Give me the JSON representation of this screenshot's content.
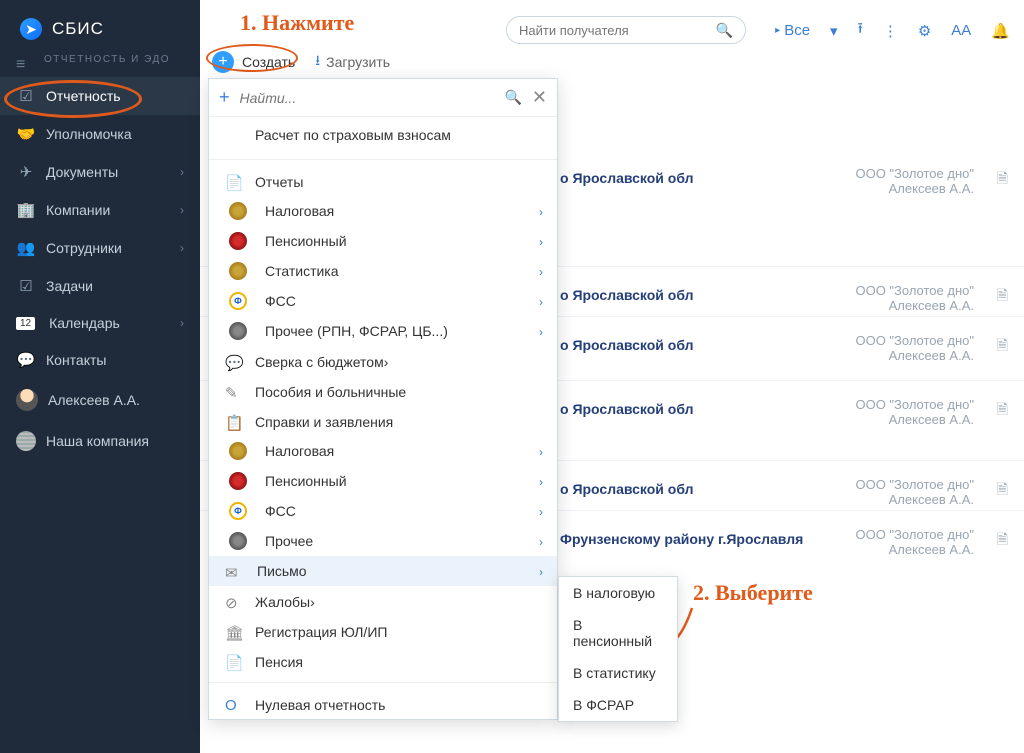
{
  "app": {
    "name": "СБИС",
    "section": "ОТЧЕТНОСТЬ И ЭДО"
  },
  "sidebar": [
    {
      "label": "Отчетность",
      "icon": "☑",
      "hasChev": false,
      "active": true
    },
    {
      "label": "Уполномочка",
      "icon": "🤝",
      "hasChev": false
    },
    {
      "label": "Документы",
      "icon": "✈",
      "hasChev": true
    },
    {
      "label": "Компании",
      "icon": "🏢",
      "hasChev": true
    },
    {
      "label": "Сотрудники",
      "icon": "👥",
      "hasChev": true
    },
    {
      "label": "Задачи",
      "icon": "☑",
      "hasChev": false
    },
    {
      "label": "Календарь",
      "icon": "",
      "badge": "12",
      "hasChev": true
    },
    {
      "label": "Контакты",
      "icon": "💬",
      "hasChev": false
    },
    {
      "label": "Алексеев А.А.",
      "avatar": true
    },
    {
      "label": "Наша компания",
      "circ": true
    }
  ],
  "search": {
    "placeholder": "Найти получателя"
  },
  "filter": {
    "label": "Все"
  },
  "toolbar": {
    "create": "Создать",
    "upload": "Загрузить"
  },
  "annotations": {
    "a1": "1. Нажмите",
    "a2": "2. Выберите"
  },
  "rows": [
    {
      "title": "о Ярославской обл",
      "org": "ООО \"Золотое дно\"",
      "person": "Алексеев А.А."
    },
    {
      "title": "о Ярославской обл",
      "org": "ООО \"Золотое дно\"",
      "person": "Алексеев А.А."
    },
    {
      "title": "о Ярославской обл",
      "org": "ООО \"Золотое дно\"",
      "person": "Алексеев А.А."
    },
    {
      "title": "о Ярославской обл",
      "org": "ООО \"Золотое дно\"",
      "person": "Алексеев А.А."
    },
    {
      "title": "о Ярославской обл",
      "org": "ООО \"Золотое дно\"",
      "person": "Алексеев А.А."
    },
    {
      "title": "Фрунзенскому району г.Ярославля",
      "org": "ООО \"Золотое дно\"",
      "person": "Алексеев А.А."
    }
  ],
  "row_offsets": [
    60,
    176,
    226,
    290,
    370,
    420
  ],
  "panel": {
    "search_placeholder": "Найти...",
    "recent": "Расчет по страховым взносам",
    "groups": [
      {
        "title": "Отчеты",
        "icon": "📄",
        "items": [
          {
            "label": "Налоговая",
            "iic": "eagle-g",
            "chev": true
          },
          {
            "label": "Пенсионный",
            "iic": "eagle-r",
            "chev": true
          },
          {
            "label": "Статистика",
            "iic": "eagle-g",
            "chev": true
          },
          {
            "label": "ФСС",
            "iic": "fss",
            "chev": true
          },
          {
            "label": "Прочее (РПН, ФСРАР, ЦБ...)",
            "iic": "eagle-k",
            "chev": true
          }
        ]
      },
      {
        "title": "Сверка с бюджетом",
        "icon": "💬",
        "chev": true
      },
      {
        "title": "Пособия и больничные",
        "icon": "✎"
      },
      {
        "title": "Справки и заявления",
        "icon": "📋",
        "items": [
          {
            "label": "Налоговая",
            "iic": "eagle-g",
            "chev": true
          },
          {
            "label": "Пенсионный",
            "iic": "eagle-r",
            "chev": true
          },
          {
            "label": "ФСС",
            "iic": "fss",
            "chev": true
          },
          {
            "label": "Прочее",
            "iic": "eagle-k",
            "chev": true
          }
        ]
      },
      {
        "title": "Письмо",
        "icon": "✉",
        "chev": true,
        "hover": true
      },
      {
        "title": "Жалобы",
        "icon": "⊘",
        "chev": true
      },
      {
        "title": "Регистрация ЮЛ/ИП",
        "icon": "🏛"
      },
      {
        "title": "Пенсия",
        "icon": "📄"
      }
    ],
    "final": {
      "label": "Нулевая отчетность",
      "icon": "O"
    }
  },
  "submenu": [
    "В налоговую",
    "В пенсионный",
    "В статистику",
    "В ФСРАР"
  ]
}
